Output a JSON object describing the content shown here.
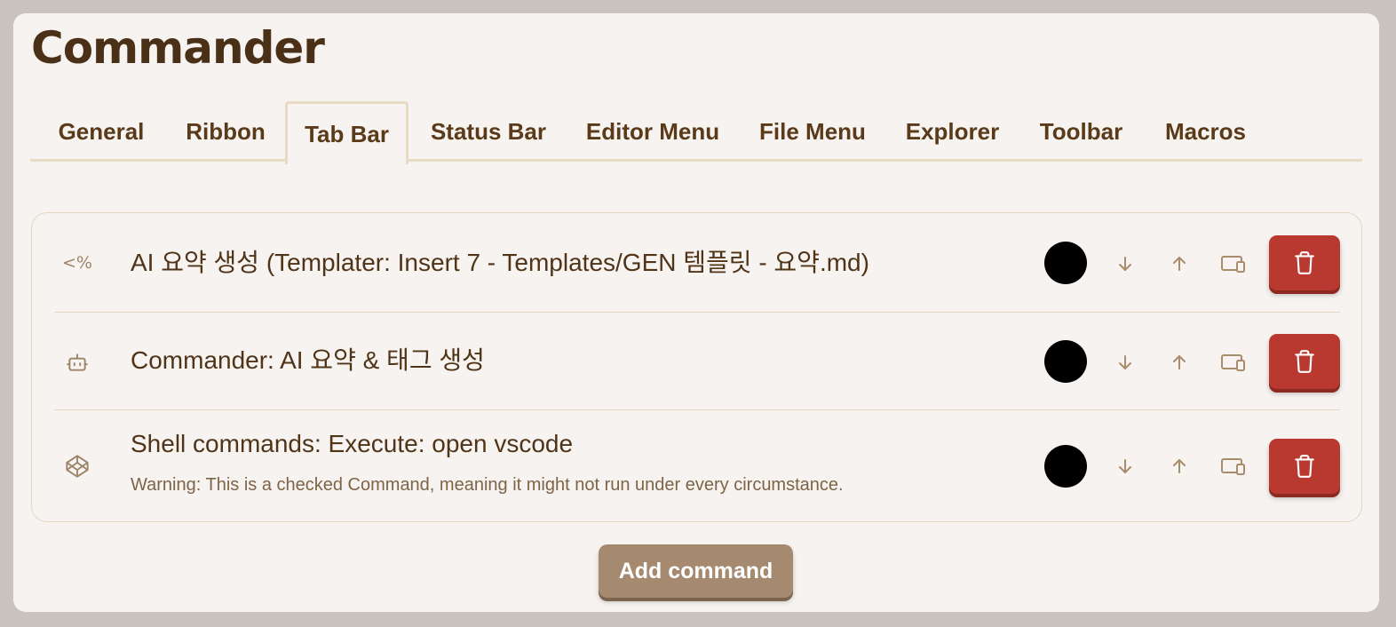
{
  "app": {
    "title": "Commander"
  },
  "tabs": [
    {
      "label": "General"
    },
    {
      "label": "Ribbon"
    },
    {
      "label": "Tab Bar",
      "active": true
    },
    {
      "label": "Status Bar"
    },
    {
      "label": "Editor Menu"
    },
    {
      "label": "File Menu"
    },
    {
      "label": "Explorer"
    },
    {
      "label": "Toolbar"
    },
    {
      "label": "Macros"
    }
  ],
  "commands": [
    {
      "icon": "templater-icon",
      "icon_text": "<%",
      "text": "AI 요약 생성  (Templater: Insert 7 - Templates/GEN 템플릿 - 요약.md)",
      "warning": "",
      "color": "#000000"
    },
    {
      "icon": "bot-icon",
      "text": "Commander: AI 요약 & 태그 생성",
      "warning": "",
      "color": "#000000"
    },
    {
      "icon": "codepen-icon",
      "text": "Shell commands: Execute: open vscode",
      "warning": "Warning: This is a checked Command, meaning it might not run under every circumstance.",
      "color": "#000000"
    }
  ],
  "actions": {
    "add_label": "Add command"
  },
  "colors": {
    "panel_bg": "#f7f3f0",
    "text": "#4f3418",
    "delete": "#b9382f",
    "add_button": "#a58a70"
  }
}
